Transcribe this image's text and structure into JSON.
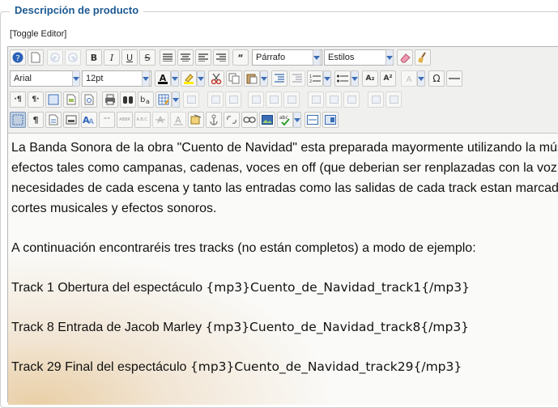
{
  "fieldset": {
    "legend": "Descripción de producto"
  },
  "toggle_editor": "[Toggle Editor]",
  "toolbar": {
    "format_select": "Párrafo",
    "styles_select": "Estilos",
    "font_select": "Arial",
    "size_select": "12pt",
    "bold": "B",
    "italic": "I",
    "underline": "U",
    "strike": "S",
    "quote_glyph": "“",
    "omega": "Ω",
    "pilcrow_ltr": "·¶",
    "pilcrow_rtl": "¶·",
    "pilcrow": "¶",
    "abbr_label": "ABBR",
    "acronym_label": "A.B.C.",
    "cite_label": "“”",
    "sub_label": "A₂",
    "sup_label": "A²",
    "spell_label": "abc"
  },
  "content": {
    "para1": [
      "La Banda Sonora de la obra \"Cuento de Navidad\" esta preparada mayormente utilizando la música",
      "efectos tales como campanas, cadenas, voces en off (que deberian ser renplazadas con la voz de",
      "necesidades de cada escena y tanto las entradas como las salidas de cada track estan marcadas",
      "cortes musicales y efectos sonoros."
    ],
    "para2": "A continuación encontraréis tres tracks (no están completos) a modo de ejemplo:",
    "tracks": [
      {
        "label": "Track 1 Obertura del espectáculo",
        "tag": "{mp3}Cuento_de_Navidad_track1{/mp3}"
      },
      {
        "label": "Track 8 Entrada de Jacob Marley",
        "tag": "{mp3}Cuento_de_Navidad_track8{/mp3}"
      },
      {
        "label": "Track 29 Final del espectáculo",
        "tag": "{mp3}Cuento_de_Navidad_track29{/mp3}"
      }
    ]
  }
}
